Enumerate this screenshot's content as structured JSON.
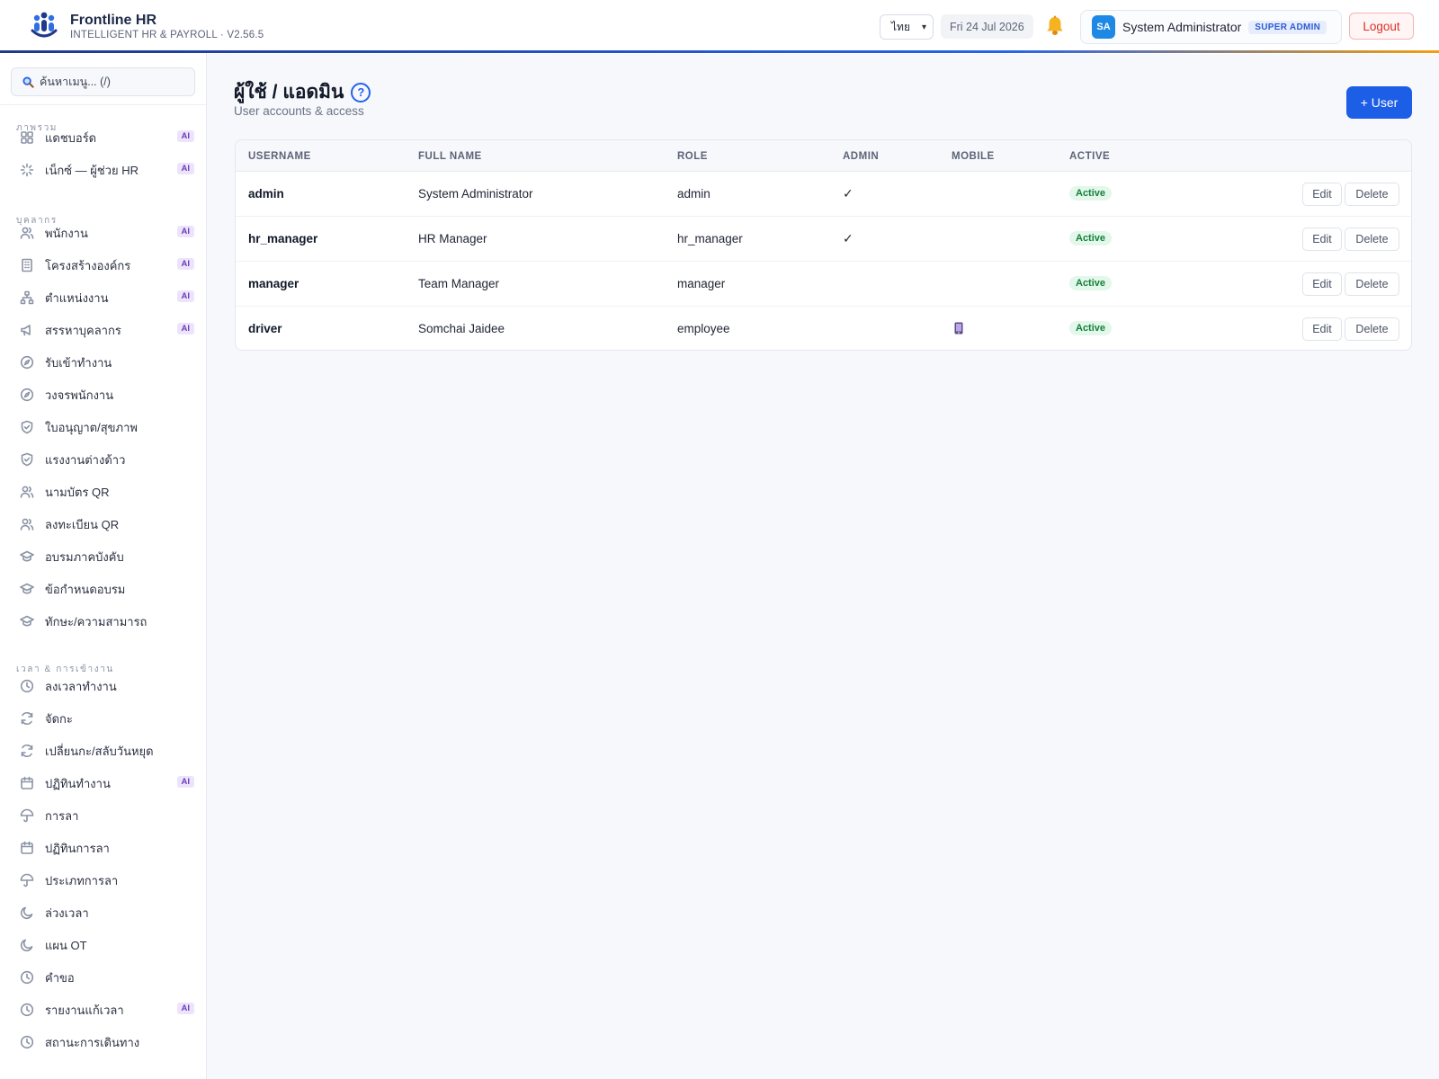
{
  "app": {
    "name": "Frontline HR",
    "subtitle": "INTELLIGENT HR & PAYROLL · V2.56.5"
  },
  "header": {
    "language": "ไทย",
    "date": "Fri 24 Jul 2026",
    "user_initials": "SA",
    "user_name": "System Administrator",
    "role_badge": "SUPER ADMIN",
    "logout_label": "Logout"
  },
  "sidebar": {
    "search_placeholder": "ค้นหาเมนู... (/)",
    "ai_tag": "AI",
    "sections": {
      "overview": "ภาพรวม",
      "people": "บุคลากร",
      "time": "เวลา & การเข้างาน"
    },
    "items": [
      {
        "label": "แดชบอร์ด",
        "icon": "grid-icon",
        "ai": true
      },
      {
        "label": "เน็กซ์ — ผู้ช่วย HR",
        "icon": "sparkle-icon",
        "ai": true
      },
      {
        "label": "พนักงาน",
        "icon": "users-icon",
        "ai": true
      },
      {
        "label": "โครงสร้างองค์กร",
        "icon": "building-icon",
        "ai": true
      },
      {
        "label": "ตำแหน่งงาน",
        "icon": "org-chart-icon",
        "ai": true
      },
      {
        "label": "สรรหาบุคลากร",
        "icon": "megaphone-icon",
        "ai": true
      },
      {
        "label": "รับเข้าทำงาน",
        "icon": "compass-icon",
        "ai": false
      },
      {
        "label": "วงจรพนักงาน",
        "icon": "compass-icon",
        "ai": false
      },
      {
        "label": "ใบอนุญาต/สุขภาพ",
        "icon": "shield-icon",
        "ai": false
      },
      {
        "label": "แรงงานต่างด้าว",
        "icon": "shield-icon",
        "ai": false
      },
      {
        "label": "นามบัตร QR",
        "icon": "users-icon",
        "ai": false
      },
      {
        "label": "ลงทะเบียน QR",
        "icon": "users-icon",
        "ai": false
      },
      {
        "label": "อบรมภาคบังคับ",
        "icon": "graduation-cap-icon",
        "ai": false
      },
      {
        "label": "ข้อกำหนดอบรม",
        "icon": "graduation-cap-icon",
        "ai": false
      },
      {
        "label": "ทักษะ/ความสามารถ",
        "icon": "graduation-cap-icon",
        "ai": false
      },
      {
        "label": "ลงเวลาทำงาน",
        "icon": "clock-icon",
        "ai": false
      },
      {
        "label": "จัดกะ",
        "icon": "refresh-icon",
        "ai": false
      },
      {
        "label": "เปลี่ยนกะ/สลับวันหยุด",
        "icon": "refresh-icon",
        "ai": false
      },
      {
        "label": "ปฏิทินทำงาน",
        "icon": "calendar-icon",
        "ai": true
      },
      {
        "label": "การลา",
        "icon": "umbrella-icon",
        "ai": false
      },
      {
        "label": "ปฏิทินการลา",
        "icon": "calendar-icon",
        "ai": false
      },
      {
        "label": "ประเภทการลา",
        "icon": "umbrella-icon",
        "ai": false
      },
      {
        "label": "ล่วงเวลา",
        "icon": "moon-icon",
        "ai": false
      },
      {
        "label": "แผน OT",
        "icon": "moon-icon",
        "ai": false
      },
      {
        "label": "คำขอ",
        "icon": "clock-icon",
        "ai": false
      },
      {
        "label": "รายงานแก้เวลา",
        "icon": "clock-icon",
        "ai": true
      },
      {
        "label": "สถานะการเดินทาง",
        "icon": "clock-icon",
        "ai": false
      }
    ]
  },
  "main": {
    "title": "ผู้ใช้ / แอดมิน",
    "subtitle": "User accounts & access",
    "add_button": "+ User",
    "columns": [
      "USERNAME",
      "FULL NAME",
      "ROLE",
      "ADMIN",
      "MOBILE",
      "ACTIVE"
    ],
    "rows": [
      {
        "username": "admin",
        "full_name": "System Administrator",
        "role": "admin",
        "admin": "✓",
        "mobile": false,
        "active": "Active"
      },
      {
        "username": "hr_manager",
        "full_name": "HR Manager",
        "role": "hr_manager",
        "admin": "✓",
        "mobile": false,
        "active": "Active"
      },
      {
        "username": "manager",
        "full_name": "Team Manager",
        "role": "manager",
        "admin": "",
        "mobile": false,
        "active": "Active"
      },
      {
        "username": "driver",
        "full_name": "Somchai Jaidee",
        "role": "employee",
        "admin": "",
        "mobile": true,
        "active": "Active"
      }
    ],
    "edit_label": "Edit",
    "delete_label": "Delete"
  },
  "colors": {
    "primary": "#1d5ee6",
    "active_green": "#16803c",
    "ai_purple": "#6d3fc0",
    "logout_red": "#d93025"
  }
}
